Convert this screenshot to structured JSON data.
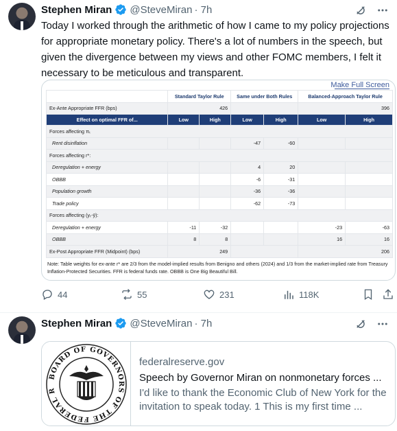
{
  "tweets": [
    {
      "author_name": "Stephen Miran",
      "handle": "@SteveMiran",
      "time": "· 7h",
      "text": "Today I worked through the arithmetic of how I came to my policy projections for appropriate monetary policy.  There's a lot of numbers in the speech, but given the divergence between my views and other FOMC members, I felt it necessary to be meticulous and transparent.",
      "media": {
        "fullscreen_label": "Make Full Screen",
        "table": {
          "col_groups": [
            "Standard Taylor Rule",
            "Same under Both Rules",
            "Balanced-Approach Taylor Rule"
          ],
          "exante_label": "Ex-Ante Appropriate FFR (bps)",
          "exante_standard": "426",
          "exante_balanced": "396",
          "effect_label": "Effect on optimal FFR of...",
          "low": "Low",
          "high": "High",
          "rows": [
            {
              "label": "Forces affecting πₜ",
              "type": "section",
              "v": [
                "",
                "",
                "",
                "",
                "",
                ""
              ]
            },
            {
              "label": "Rent disinflation",
              "type": "item",
              "v": [
                "",
                "",
                "-47",
                "-60",
                "",
                ""
              ]
            },
            {
              "label": "Forces affecting r*:",
              "type": "section",
              "v": [
                "",
                "",
                "",
                "",
                "",
                ""
              ]
            },
            {
              "label": "Deregulation + energy",
              "type": "item",
              "v": [
                "",
                "",
                "4",
                "20",
                "",
                ""
              ]
            },
            {
              "label": "OBBB",
              "type": "item",
              "v": [
                "",
                "",
                "-6",
                "-31",
                "",
                ""
              ]
            },
            {
              "label": "Population growth",
              "type": "item",
              "v": [
                "",
                "",
                "-36",
                "-36",
                "",
                ""
              ]
            },
            {
              "label": "Trade policy",
              "type": "item",
              "v": [
                "",
                "",
                "-62",
                "-73",
                "",
                ""
              ]
            },
            {
              "label": "Forces affecting (yₜ-ȳ):",
              "type": "section",
              "v": [
                "",
                "",
                "",
                "",
                "",
                ""
              ]
            },
            {
              "label": "Deregulation + energy",
              "type": "item",
              "v": [
                "-11",
                "-32",
                "",
                "",
                "-23",
                "-63"
              ]
            },
            {
              "label": "OBBB",
              "type": "item",
              "v": [
                "8",
                "8",
                "",
                "",
                "16",
                "16"
              ]
            }
          ],
          "expost_label": "Ex-Post Appropriate FFR (Midpoint) (bps)",
          "expost_standard": "249",
          "expost_balanced": "206"
        },
        "note": "Note: Table weights for ex-ante r* are 2/3 from the model-implied results from Benigno and others (2024) and 1/3 from the market-implied rate from Treasury Inflation-Protected Securities. FFR is federal funds rate. OBBB is One Big Beautiful Bill."
      },
      "actions": {
        "replies": "44",
        "reposts": "55",
        "likes": "231",
        "views": "118K"
      }
    },
    {
      "author_name": "Stephen Miran",
      "handle": "@SteveMiran",
      "time": "· 7h",
      "card": {
        "domain": "federalreserve.gov",
        "title": "Speech by Governor Miran on nonmonetary forces ...",
        "description": "I'd like to thank the Economic Club of New York for the invitation to speak today. 1 This is my first time ...",
        "seal_text": "BOARD OF GOVERNORS OF THE FEDERAL RESERVE SYSTEM"
      }
    }
  ],
  "colors": {
    "verified": "#1d9bf0",
    "table_header_blue": "#1f3e78",
    "secondary_text": "#536471"
  },
  "icons": [
    "verified-badge-icon",
    "grok-icon",
    "more-icon",
    "reply-icon",
    "repost-icon",
    "like-icon",
    "views-icon",
    "bookmark-icon",
    "share-icon",
    "federal-reserve-seal"
  ]
}
